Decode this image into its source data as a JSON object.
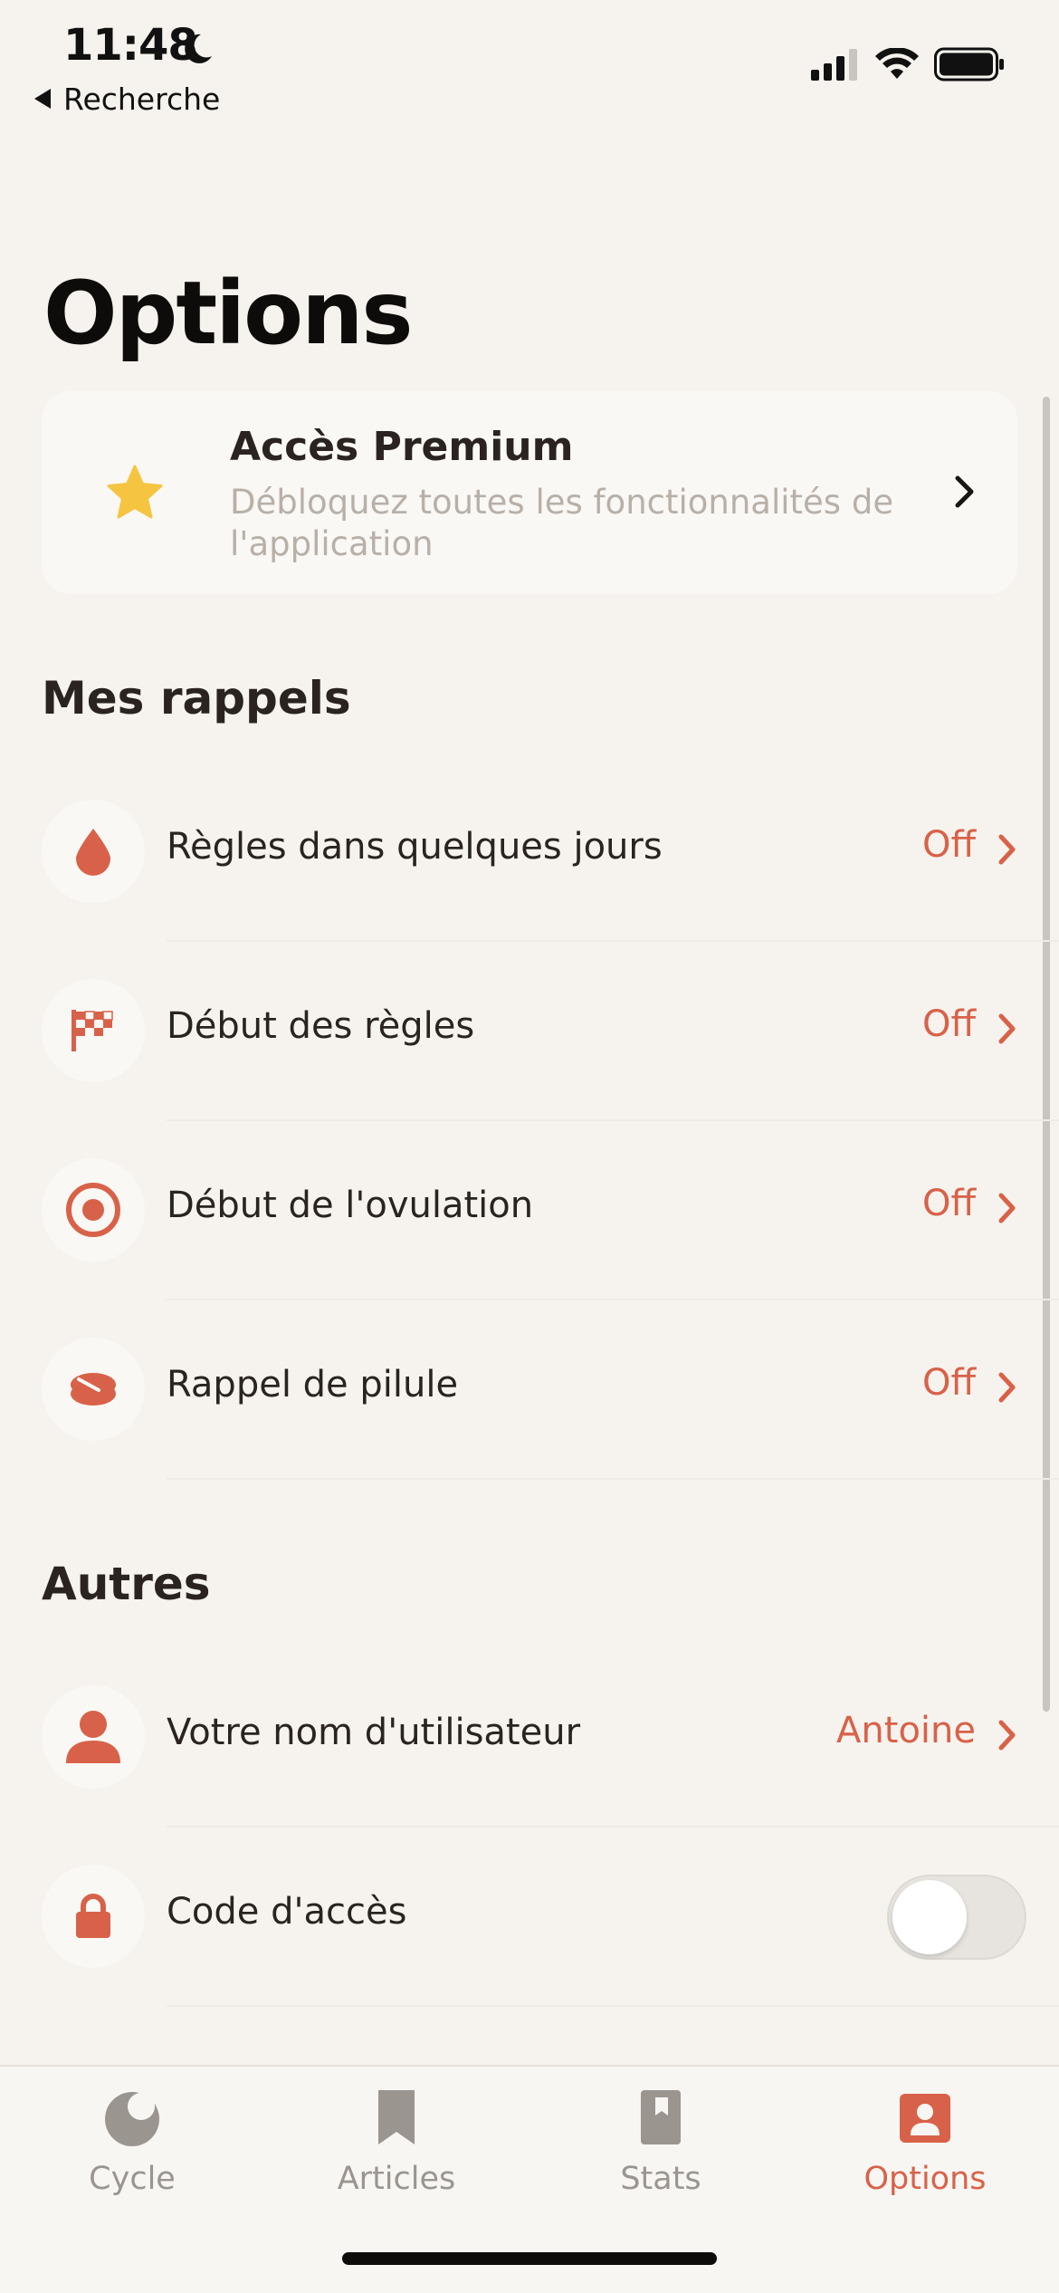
{
  "status_bar": {
    "time": "11:48",
    "back_label": "Recherche",
    "icons": [
      "moon-icon",
      "signal-icon",
      "wifi-icon",
      "battery-icon"
    ]
  },
  "page": {
    "title": "Options"
  },
  "premium": {
    "title": "Accès Premium",
    "subtitle": "Débloquez toutes les fonctionnalités de l'application",
    "icon": "star-icon"
  },
  "reminders": {
    "header": "Mes rappels",
    "items": [
      {
        "label": "Règles dans quelques jours",
        "value": "Off",
        "icon": "drop-icon"
      },
      {
        "label": "Début des règles",
        "value": "Off",
        "icon": "checkered-flag-icon"
      },
      {
        "label": "Début de l'ovulation",
        "value": "Off",
        "icon": "target-icon"
      },
      {
        "label": "Rappel de pilule",
        "value": "Off",
        "icon": "pill-icon"
      }
    ]
  },
  "others": {
    "header": "Autres",
    "items": [
      {
        "label": "Votre nom d'utilisateur",
        "value": "Antoine",
        "icon": "user-icon"
      },
      {
        "label": "Code d'accès",
        "toggle_on": false,
        "icon": "lock-icon"
      }
    ]
  },
  "tabbar": {
    "items": [
      {
        "label": "Cycle",
        "icon": "moon-cycle-icon",
        "active": false
      },
      {
        "label": "Articles",
        "icon": "bookmark-icon",
        "active": false
      },
      {
        "label": "Stats",
        "icon": "book-icon",
        "active": false
      },
      {
        "label": "Options",
        "icon": "profile-icon",
        "active": true
      }
    ]
  },
  "colors": {
    "accent": "#d86249",
    "star": "#f5c542",
    "background": "#f6f3ee",
    "card": "#faf8f4",
    "muted_text": "#b8b0a8",
    "tab_inactive": "#9b9590"
  }
}
